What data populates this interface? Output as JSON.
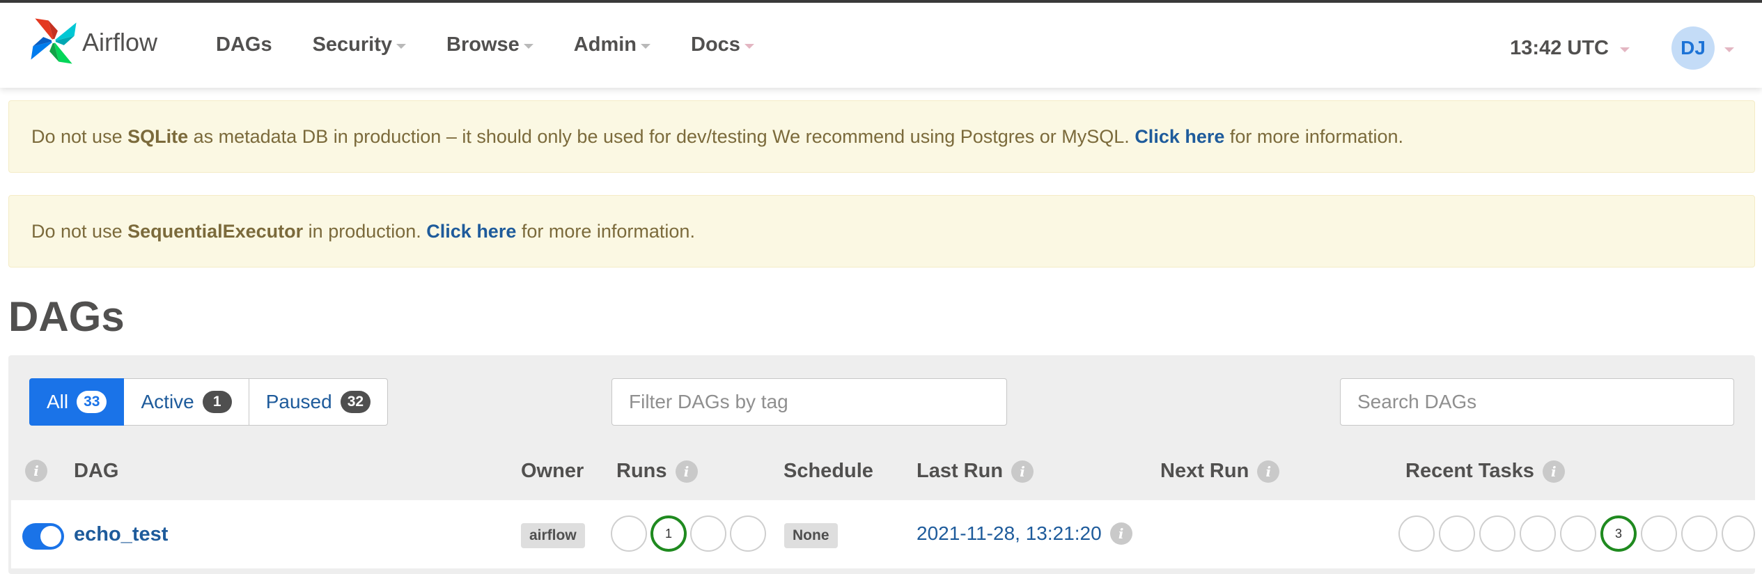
{
  "navbar": {
    "brand": "Airflow",
    "items": [
      {
        "label": "DAGs",
        "dropdown": false
      },
      {
        "label": "Security",
        "dropdown": true
      },
      {
        "label": "Browse",
        "dropdown": true
      },
      {
        "label": "Admin",
        "dropdown": true
      },
      {
        "label": "Docs",
        "dropdown": true
      }
    ],
    "clock": "13:42 UTC",
    "user_initials": "DJ"
  },
  "alerts": [
    {
      "pre": "Do not use ",
      "bold": "SQLite",
      "mid": " as metadata DB in production – it should only be used for dev/testing We recommend using Postgres or MySQL. ",
      "link": "Click here",
      "post": " for more information."
    },
    {
      "pre": "Do not use ",
      "bold": "SequentialExecutor",
      "mid": " in production. ",
      "link": "Click here",
      "post": " for more information."
    }
  ],
  "page": {
    "title": "DAGs"
  },
  "filters": {
    "tabs": [
      {
        "label": "All",
        "count": "33",
        "active": true
      },
      {
        "label": "Active",
        "count": "1",
        "active": false
      },
      {
        "label": "Paused",
        "count": "32",
        "active": false
      }
    ],
    "tag_placeholder": "Filter DAGs by tag",
    "search_placeholder": "Search DAGs"
  },
  "table": {
    "headers": {
      "dag": "DAG",
      "owner": "Owner",
      "runs": "Runs",
      "schedule": "Schedule",
      "last_run": "Last Run",
      "next_run": "Next Run",
      "recent_tasks": "Recent Tasks"
    },
    "info_glyph": "i",
    "rows": [
      {
        "paused": false,
        "dag_id": "echo_test",
        "owner": "airflow",
        "runs": [
          "",
          "1",
          "",
          ""
        ],
        "schedule": "None",
        "last_run": "2021-11-28, 13:21:20",
        "next_run": "",
        "recent_tasks": [
          "",
          "",
          "",
          "",
          "",
          "3",
          "",
          "",
          ""
        ]
      }
    ]
  },
  "colors": {
    "accent": "#1a73e8",
    "link": "#1e5b9b",
    "success": "#1f8a1f",
    "alert_bg": "#fbf8e3"
  },
  "icons": [
    "airflow-logo-icon",
    "caret-down-icon",
    "info-icon"
  ]
}
